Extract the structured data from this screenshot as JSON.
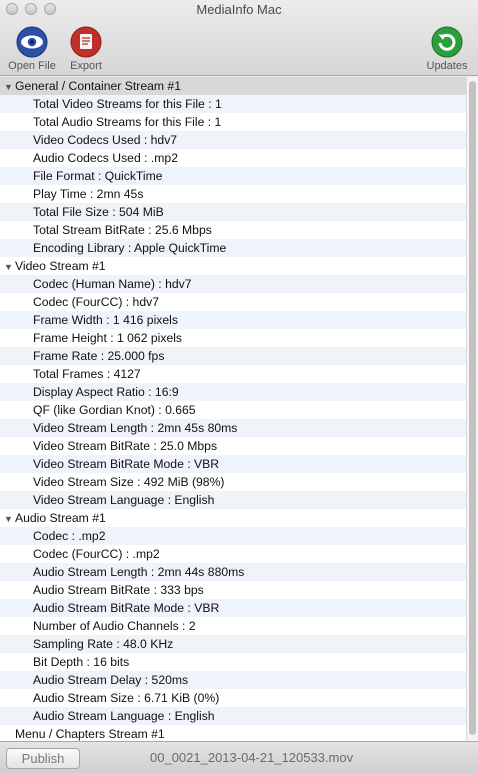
{
  "window": {
    "title": "MediaInfo Mac"
  },
  "toolbar": {
    "open_file": "Open File",
    "export": "Export",
    "updates": "Updates"
  },
  "colors": {
    "open_icon": "#2c4fa8",
    "export_icon": "#c0302b",
    "updates_icon": "#2aa03a"
  },
  "sections": [
    {
      "title": "General / Container Stream #1",
      "expanded": true,
      "items": [
        "Total Video Streams for this File : 1",
        "Total Audio Streams for this File : 1",
        "Video Codecs Used : hdv7",
        "Audio Codecs Used : .mp2",
        "File Format : QuickTime",
        "Play Time : 2mn 45s",
        "Total File Size : 504 MiB",
        "Total Stream BitRate : 25.6 Mbps",
        "Encoding Library : Apple QuickTime"
      ]
    },
    {
      "title": "Video Stream #1",
      "expanded": true,
      "items": [
        "Codec (Human Name) : hdv7",
        "Codec (FourCC) : hdv7",
        "Frame Width : 1 416 pixels",
        "Frame Height : 1 062 pixels",
        "Frame Rate : 25.000 fps",
        "Total Frames : 4127",
        "Display Aspect Ratio : 16:9",
        "QF (like Gordian Knot) : 0.665",
        "Video Stream Length : 2mn 45s 80ms",
        "Video Stream BitRate : 25.0 Mbps",
        "Video Stream BitRate Mode : VBR",
        "Video Stream Size : 492 MiB (98%)",
        "Video Stream Language : English"
      ]
    },
    {
      "title": "Audio Stream #1",
      "expanded": true,
      "items": [
        "Codec : .mp2",
        "Codec (FourCC) : .mp2",
        "Audio Stream Length : 2mn 44s 880ms",
        "Audio Stream BitRate : 333 bps",
        "Audio Stream BitRate Mode : VBR",
        "Number of Audio Channels : 2",
        "Sampling Rate : 48.0 KHz",
        "Bit Depth : 16 bits",
        "Audio Stream Delay : 520ms",
        "Audio Stream Size : 6.71 KiB (0%)",
        "Audio Stream Language : English"
      ]
    },
    {
      "title": "Menu / Chapters Stream #1",
      "expanded": false,
      "items": []
    }
  ],
  "bottom": {
    "publish": "Publish",
    "filename": "00_0021_2013-04-21_120533.mov"
  }
}
